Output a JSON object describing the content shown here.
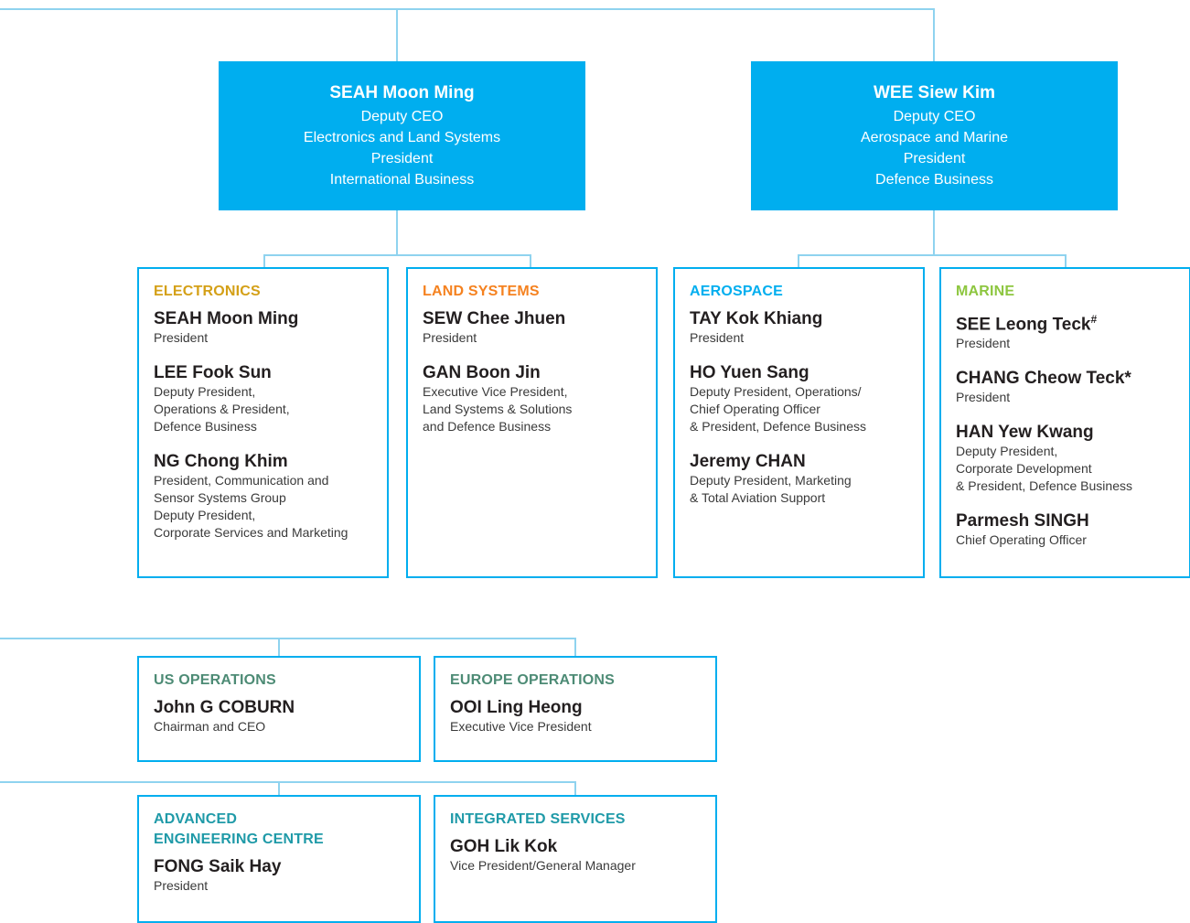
{
  "colors": {
    "line": "#8fd3ef",
    "exec_fill": "#00aeef",
    "box_border": "#00aeef",
    "electronics": "#d4a017",
    "land_systems": "#f58220",
    "aerospace": "#00aeef",
    "marine": "#8dc63f",
    "operations": "#4d8b75",
    "services": "#1f9aa8"
  },
  "executives": [
    {
      "name": "SEAH Moon Ming",
      "lines": [
        "Deputy CEO",
        "Electronics and Land Systems",
        "President",
        "International Business"
      ]
    },
    {
      "name": "WEE Siew Kim",
      "lines": [
        "Deputy CEO",
        "Aerospace and Marine",
        "President",
        "Defence Business"
      ]
    }
  ],
  "divisions": [
    {
      "heading": "ELECTRONICS",
      "people": [
        {
          "name": "SEAH Moon Ming",
          "role": "President"
        },
        {
          "name": "LEE Fook Sun",
          "role": "Deputy President,\nOperations & President,\nDefence Business"
        },
        {
          "name": "NG Chong Khim",
          "role": "President, Communication and\nSensor Systems Group\nDeputy President,\nCorporate Services and Marketing"
        }
      ]
    },
    {
      "heading": "LAND SYSTEMS",
      "people": [
        {
          "name": "SEW Chee Jhuen",
          "role": "President"
        },
        {
          "name": "GAN Boon Jin",
          "role": "Executive Vice President,\nLand Systems & Solutions\nand Defence Business"
        }
      ]
    },
    {
      "heading": "AEROSPACE",
      "people": [
        {
          "name": "TAY Kok Khiang",
          "role": "President"
        },
        {
          "name": "HO Yuen Sang",
          "role": "Deputy President, Operations/\nChief Operating Officer\n& President, Defence Business"
        },
        {
          "name": "Jeremy CHAN",
          "role": "Deputy President, Marketing\n& Total Aviation Support"
        }
      ]
    },
    {
      "heading": "MARINE",
      "people": [
        {
          "name": "SEE Leong Teck",
          "mark": "#",
          "role": "President"
        },
        {
          "name": "CHANG Cheow Teck",
          "mark": "*",
          "role": "President"
        },
        {
          "name": "HAN Yew Kwang",
          "role": "Deputy President,\nCorporate Development\n& President, Defence Business"
        },
        {
          "name": "Parmesh SINGH",
          "role": "Chief Operating Officer"
        }
      ]
    }
  ],
  "operations": [
    {
      "heading": "US OPERATIONS",
      "people": [
        {
          "name": "John G COBURN",
          "role": "Chairman and CEO"
        }
      ]
    },
    {
      "heading": "EUROPE OPERATIONS",
      "people": [
        {
          "name": "OOI Ling Heong",
          "role": "Executive Vice President"
        }
      ]
    }
  ],
  "centres": [
    {
      "heading": "ADVANCED\nENGINEERING CENTRE",
      "people": [
        {
          "name": "FONG Saik Hay",
          "role": "President"
        }
      ]
    },
    {
      "heading": "INTEGRATED SERVICES",
      "people": [
        {
          "name": "GOH Lik Kok",
          "role": "Vice President/General Manager"
        }
      ]
    }
  ]
}
